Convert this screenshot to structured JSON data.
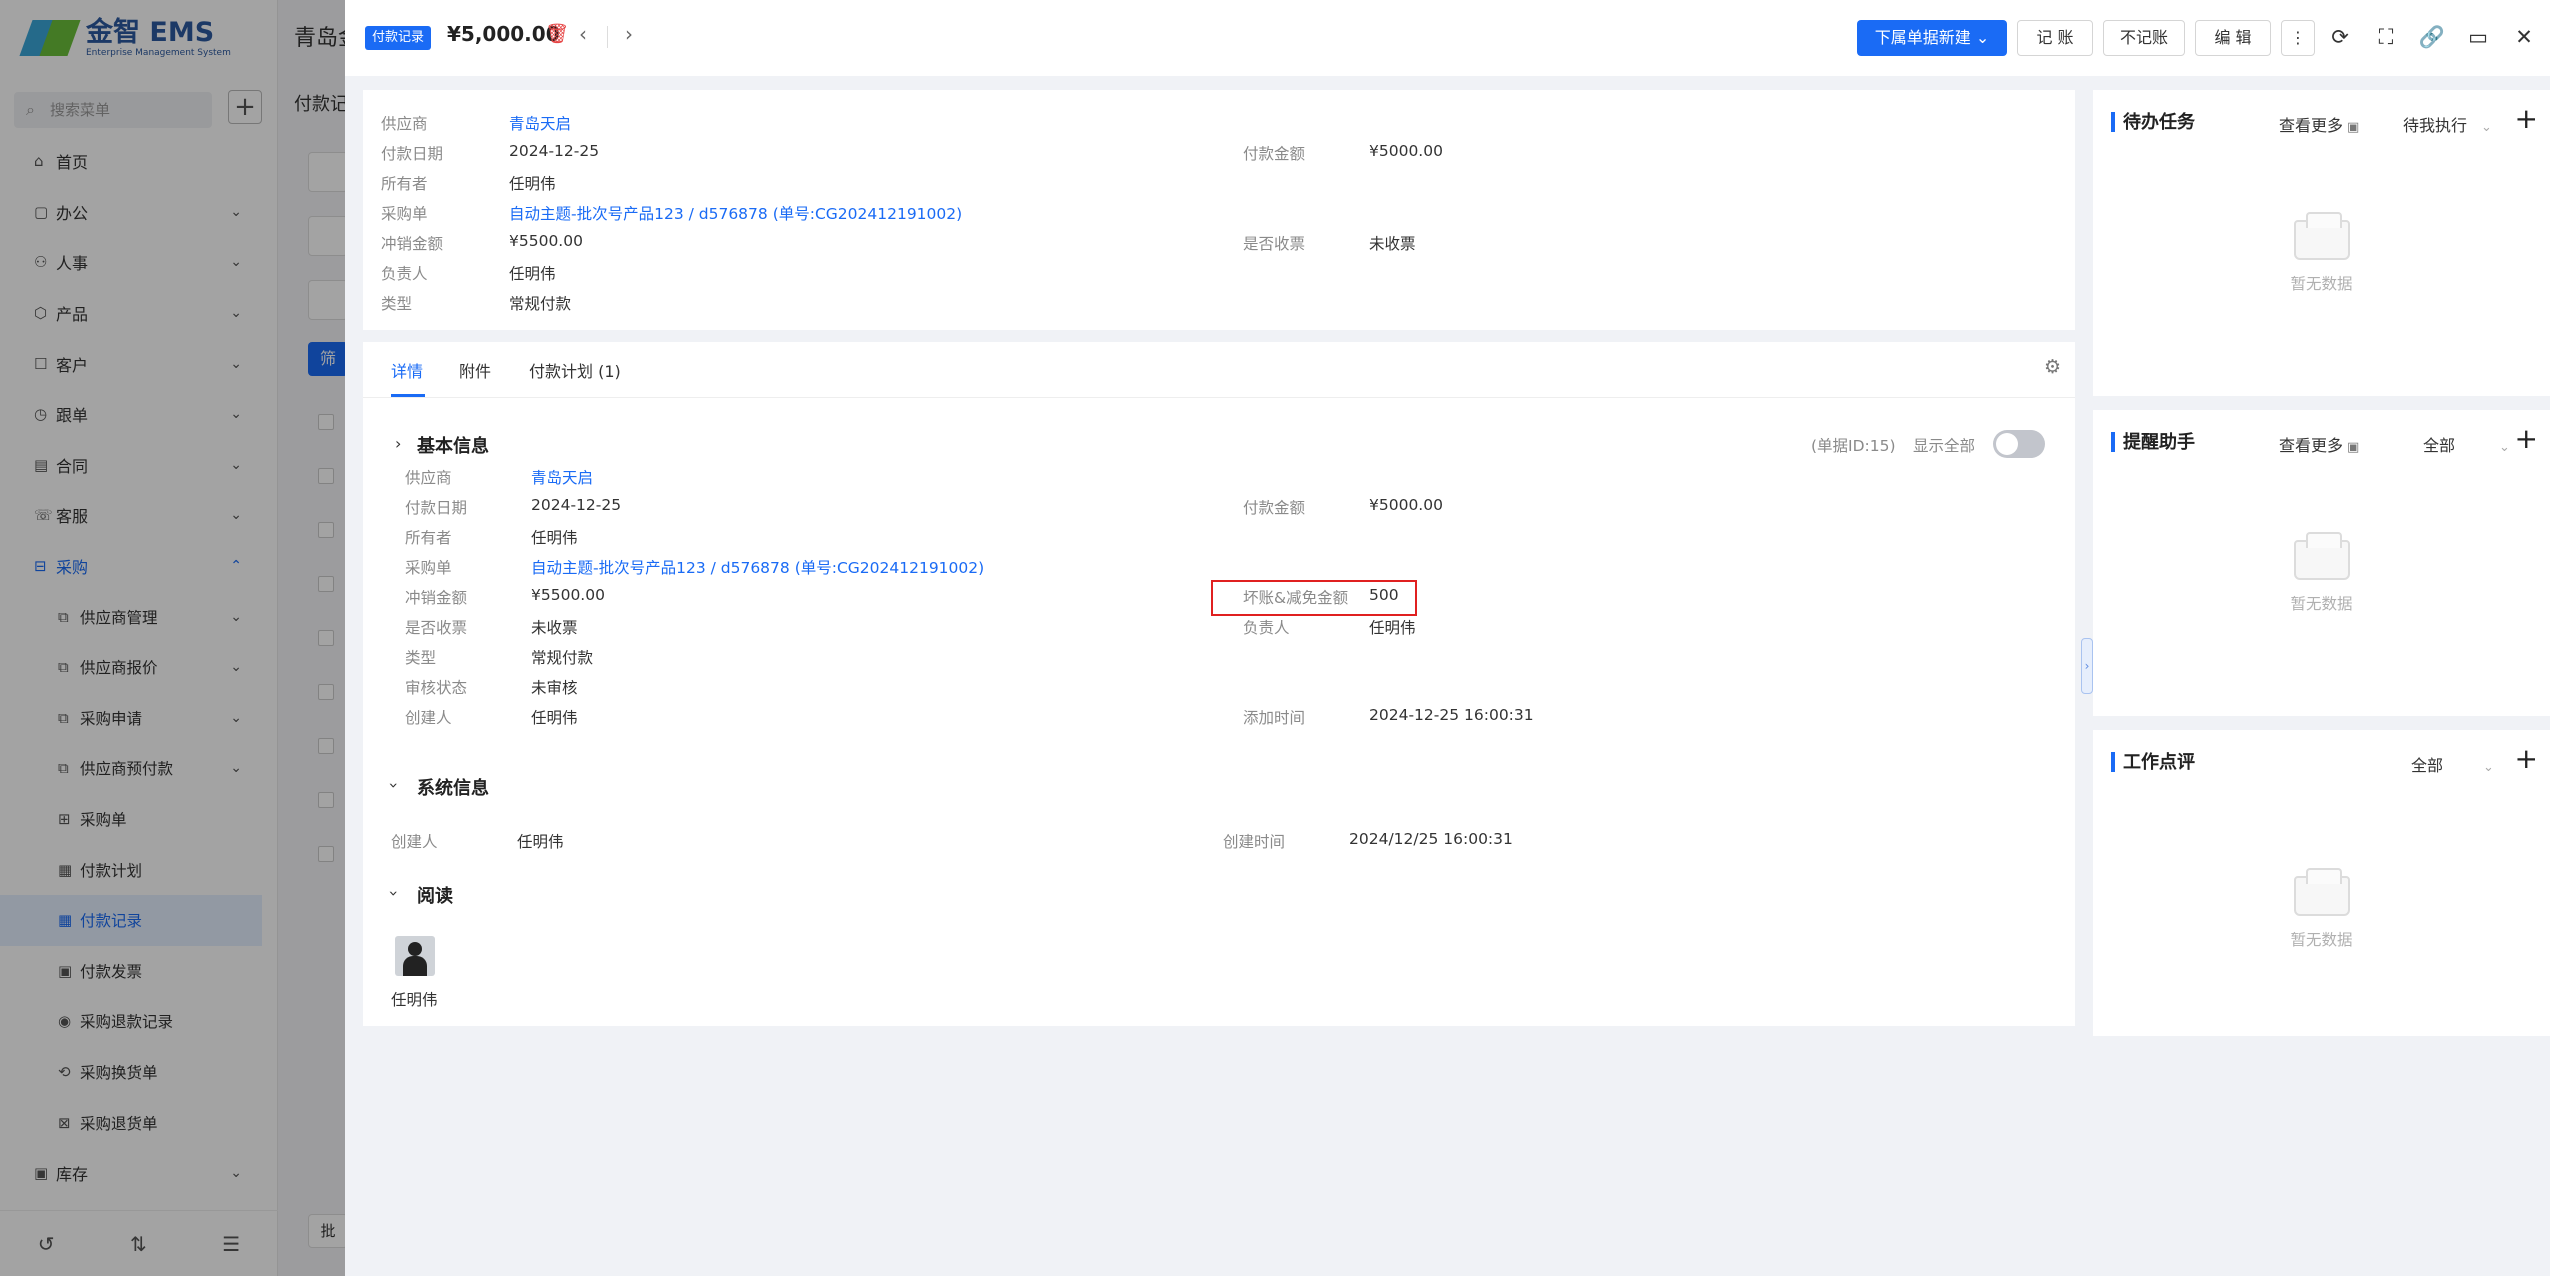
{
  "logo": {
    "brand": "金智 EMS",
    "tagline": "Enterprise Management System"
  },
  "sidebar": {
    "search_placeholder": "搜索菜单",
    "items": [
      {
        "label": "首页",
        "icon": "home-icon",
        "chevron": false
      },
      {
        "label": "办公",
        "icon": "briefcase-icon",
        "chevron": true
      },
      {
        "label": "人事",
        "icon": "people-icon",
        "chevron": true
      },
      {
        "label": "产品",
        "icon": "cube-icon",
        "chevron": true
      },
      {
        "label": "客户",
        "icon": "customer-icon",
        "chevron": true
      },
      {
        "label": "跟单",
        "icon": "clock-icon",
        "chevron": true
      },
      {
        "label": "合同",
        "icon": "contract-icon",
        "chevron": true
      },
      {
        "label": "客服",
        "icon": "service-icon",
        "chevron": true
      },
      {
        "label": "采购",
        "icon": "cart-icon",
        "chevron": true,
        "open": true
      },
      {
        "label": "供应商管理",
        "icon": "copy-icon",
        "chevron": true,
        "sub": true
      },
      {
        "label": "供应商报价",
        "icon": "copy-icon",
        "chevron": true,
        "sub": true
      },
      {
        "label": "采购申请",
        "icon": "copy-icon",
        "chevron": true,
        "sub": true
      },
      {
        "label": "供应商预付款",
        "icon": "copy-icon",
        "chevron": true,
        "sub": true
      },
      {
        "label": "采购单",
        "icon": "bag-icon",
        "chevron": false,
        "sub": true
      },
      {
        "label": "付款计划",
        "icon": "doc-icon",
        "chevron": false,
        "sub": true
      },
      {
        "label": "付款记录",
        "icon": "doc-icon",
        "chevron": false,
        "sub": true,
        "active": true
      },
      {
        "label": "付款发票",
        "icon": "invoice-icon",
        "chevron": false,
        "sub": true
      },
      {
        "label": "采购退款记录",
        "icon": "refund-icon",
        "chevron": false,
        "sub": true
      },
      {
        "label": "采购换货单",
        "icon": "exchange-icon",
        "chevron": false,
        "sub": true
      },
      {
        "label": "采购退货单",
        "icon": "return-icon",
        "chevron": false,
        "sub": true
      },
      {
        "label": "库存",
        "icon": "box-icon",
        "chevron": true
      }
    ]
  },
  "background_page": {
    "title": "青岛金",
    "crumb": "付款记",
    "filter_btn": "筛",
    "batch_btn": "批"
  },
  "header": {
    "badge": "付款记录",
    "amount": "¥5,000.00",
    "new_button": "下属单据新建",
    "buttons": [
      "记 账",
      "不记账",
      "编 辑"
    ]
  },
  "summary": {
    "rows": [
      {
        "label": "供应商",
        "value": "青岛天启",
        "link": true
      },
      {
        "label": "付款日期",
        "value": "2024-12-25",
        "r_label": "付款金额",
        "r_value": "¥5000.00"
      },
      {
        "label": "所有者",
        "value": "任明伟"
      },
      {
        "label": "采购单",
        "value": "自动主题-批次号产品123 / d576878 (单号:CG202412191002)",
        "link": true
      },
      {
        "label": "冲销金额",
        "value": "¥5500.00",
        "r_label": "是否收票",
        "r_value": "未收票"
      },
      {
        "label": "负责人",
        "value": "任明伟"
      },
      {
        "label": "类型",
        "value": "常规付款"
      }
    ]
  },
  "tabs": [
    "详情",
    "附件",
    "付款计划 (1)"
  ],
  "basic": {
    "title": "基本信息",
    "doc_id": "(单据ID:15)",
    "show_all": "显示全部",
    "rows": [
      {
        "label": "供应商",
        "value": "青岛天启",
        "link": true
      },
      {
        "label": "付款日期",
        "value": "2024-12-25",
        "r_label": "付款金额",
        "r_value": "¥5000.00"
      },
      {
        "label": "所有者",
        "value": "任明伟"
      },
      {
        "label": "采购单",
        "value": "自动主题-批次号产品123 / d576878 (单号:CG202412191002)",
        "link": true
      },
      {
        "label": "冲销金额",
        "value": "¥5500.00",
        "r_label": "坏账&减免金额",
        "r_value": "500"
      },
      {
        "label": "是否收票",
        "value": "未收票",
        "r_label": "负责人",
        "r_value": "任明伟"
      },
      {
        "label": "类型",
        "value": "常规付款"
      },
      {
        "label": "审核状态",
        "value": "未审核"
      },
      {
        "label": "创建人",
        "value": "任明伟",
        "r_label": "添加时间",
        "r_value": "2024-12-25 16:00:31"
      }
    ]
  },
  "system": {
    "title": "系统信息",
    "creator_label": "创建人",
    "creator": "任明伟",
    "created_label": "创建时间",
    "created": "2024/12/25 16:00:31"
  },
  "reading": {
    "title": "阅读",
    "reader": "任明伟"
  },
  "panels": [
    {
      "title": "待办任务",
      "more": "查看更多",
      "filter": "待我执行",
      "empty": "暂无数据"
    },
    {
      "title": "提醒助手",
      "more": "查看更多",
      "filter": "全部",
      "empty": "暂无数据"
    },
    {
      "title": "工作点评",
      "more": "",
      "filter": "全部",
      "empty": "暂无数据"
    }
  ],
  "colors": {
    "primary": "#1a6bf5",
    "highlight": "#e02020"
  }
}
